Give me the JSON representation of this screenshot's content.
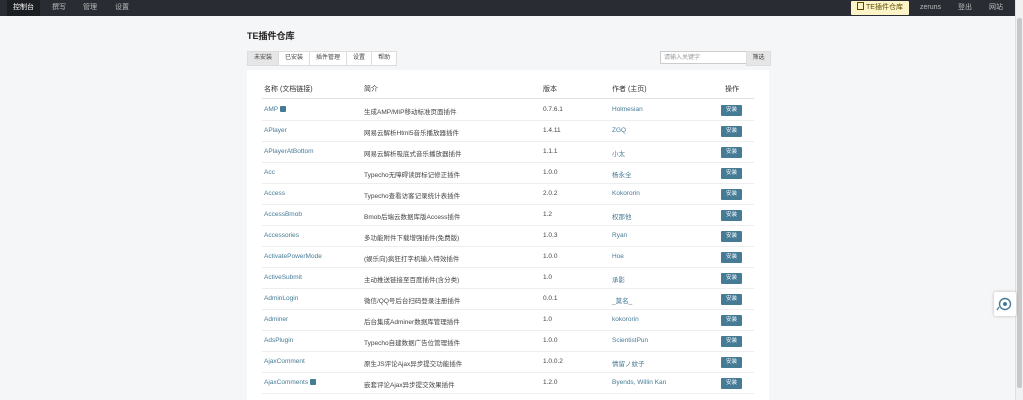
{
  "topnav": {
    "dashboard": "控制台",
    "write": "撰写",
    "manage": "管理",
    "settings": "设置",
    "plugin_store": "TE插件仓库",
    "user": "zeruns",
    "logout": "登出",
    "site": "网站"
  },
  "page_title": "TE插件仓库",
  "tabs": [
    "未安装",
    "已安装",
    "插件管理",
    "设置",
    "帮助"
  ],
  "search": {
    "placeholder": "请输入关键字",
    "button": "筛选"
  },
  "table": {
    "headers": [
      "名称 (文档链接)",
      "简介",
      "版本",
      "作者 (主页)",
      "操作"
    ],
    "rows": [
      {
        "name": "AMP",
        "doc": true,
        "desc": "生成AMP/MIP移动标准页面插件",
        "version": "0.7.6.1",
        "author": "Holmesian",
        "action": "安装"
      },
      {
        "name": "APlayer",
        "doc": false,
        "desc": "网易云解析Html5音乐播放器插件",
        "version": "1.4.11",
        "author": "ZGQ",
        "action": "安装"
      },
      {
        "name": "APlayerAtBottom",
        "doc": false,
        "desc": "网易云解析吸底式音乐播放器插件",
        "version": "1.1.1",
        "author": "小太",
        "action": "安装"
      },
      {
        "name": "Acc",
        "doc": false,
        "desc": "Typecho无障碍读屏标记修正插件",
        "version": "1.0.0",
        "author": "杨永全",
        "action": "安装"
      },
      {
        "name": "Access",
        "doc": false,
        "desc": "Typecho查看访客记录统计表插件",
        "version": "2.0.2",
        "author": "Kokororin",
        "action": "安装"
      },
      {
        "name": "AccessBmob",
        "doc": false,
        "desc": "Bmob后端云数据库版Access插件",
        "version": "1.2",
        "author": "权那他",
        "action": "安装"
      },
      {
        "name": "Accessories",
        "doc": false,
        "desc": "多功能附件下载增强插件(免费版)",
        "version": "1.0.3",
        "author": "Ryan",
        "action": "安装"
      },
      {
        "name": "ActivatePowerMode",
        "doc": false,
        "desc": "(娱乐向)疯狂打字机输入特效插件",
        "version": "1.0.0",
        "author": "Hoe",
        "action": "安装"
      },
      {
        "name": "ActiveSubmit",
        "doc": false,
        "desc": "主动推送链接至百度插件(含分类)",
        "version": "1.0",
        "author": "承影",
        "action": "安装"
      },
      {
        "name": "AdminLogin",
        "doc": false,
        "desc": "微信/QQ号后台扫码登录注册插件",
        "version": "0.0.1",
        "author": "_莫名_",
        "action": "安装"
      },
      {
        "name": "Adminer",
        "doc": false,
        "desc": "后台集成Adminer数据库管理插件",
        "version": "1.0",
        "author": "kokororin",
        "action": "安装"
      },
      {
        "name": "AdsPlugin",
        "doc": false,
        "desc": "Typecho自建数据广告位管理插件",
        "version": "1.0.0",
        "author": "ScientistPun",
        "action": "安装"
      },
      {
        "name": "AjaxComment",
        "doc": false,
        "desc": "原生JS评论Ajax异步提交功能插件",
        "version": "1.0.0.2",
        "author": "情留ノ蚊子",
        "action": "安装"
      },
      {
        "name": "AjaxComments",
        "doc": true,
        "desc": "嵌套评论Ajax异步提交效果插件",
        "version": "1.2.0",
        "author": "Byends, Willin Kan",
        "action": "安装"
      }
    ]
  }
}
